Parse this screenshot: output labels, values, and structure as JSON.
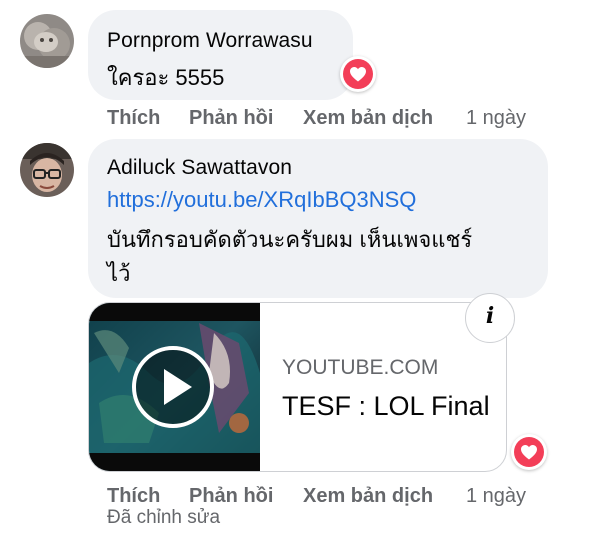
{
  "comments": [
    {
      "author": "Pornprom Worrawasu",
      "text": "ใครอะ 5555",
      "reaction_icon": "heart-icon",
      "reaction_color": "#f33e58",
      "actions": {
        "like": "Thích",
        "reply": "Phản hồi",
        "translate": "Xem bản dịch",
        "time": "1 ngày"
      }
    },
    {
      "author": "Adiluck Sawattavon",
      "link": "https://youtu.be/XRqIbBQ3NSQ",
      "text_line1": "บันทึกรอบคัดตัวนะครับผม เห็นเพจแชร์",
      "text_line2": "ไว้",
      "reaction_icon": "heart-icon",
      "reaction_color": "#f33e58",
      "link_preview": {
        "domain": "YOUTUBE.COM",
        "title": "TESF : LOL Final",
        "thumbnail_icon": "play-icon",
        "info_icon": "info-icon"
      },
      "actions": {
        "like": "Thích",
        "reply": "Phản hồi",
        "translate": "Xem bản dịch",
        "time": "1 ngày"
      },
      "edited": "Đã chỉnh sửa"
    }
  ]
}
